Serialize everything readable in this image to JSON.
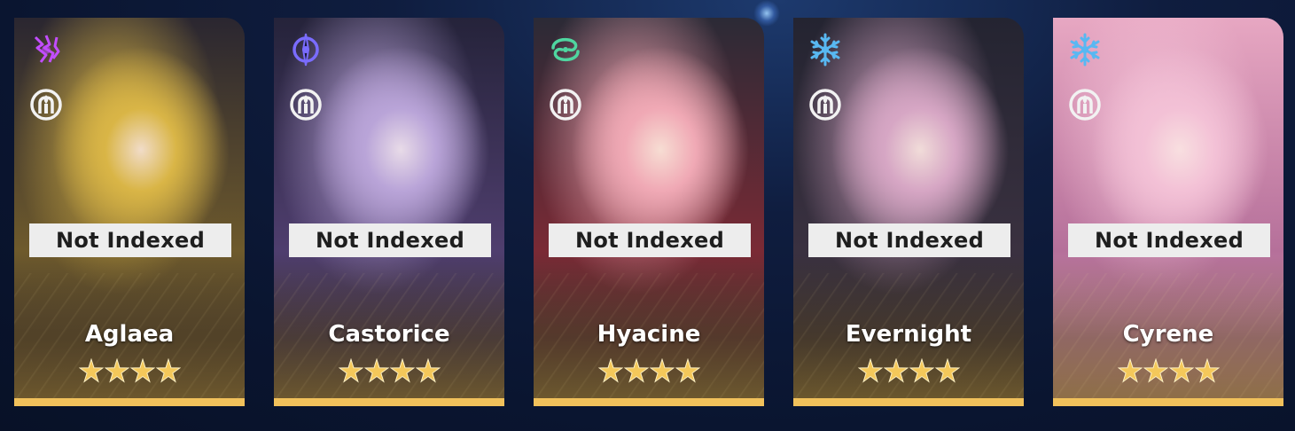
{
  "cards": [
    {
      "name": "Aglaea",
      "status": "Not Indexed",
      "element": "lightning-icon",
      "element_color": "#c24dff",
      "path": "remembrance-icon",
      "rarity": 4,
      "art": {
        "top": "#2a2630",
        "mid": "#6e5a2c",
        "accent": "#d9b546",
        "skin": "#f1dcc8"
      }
    },
    {
      "name": "Castorice",
      "status": "Not Indexed",
      "element": "quantum-icon",
      "element_color": "#7a6cff",
      "path": "remembrance-icon",
      "rarity": 4,
      "art": {
        "top": "#25233a",
        "mid": "#4f3e6e",
        "accent": "#b9a4d8",
        "skin": "#e8dbe8"
      }
    },
    {
      "name": "Hyacine",
      "status": "Not Indexed",
      "element": "wind-icon",
      "element_color": "#4fd6a0",
      "path": "remembrance-icon",
      "rarity": 4,
      "art": {
        "top": "#2b2a36",
        "mid": "#7a2a35",
        "accent": "#f0a9b5",
        "skin": "#f7ddd3"
      }
    },
    {
      "name": "Evernight",
      "status": "Not Indexed",
      "element": "ice-icon",
      "element_color": "#58b8f2",
      "path": "remembrance-icon",
      "rarity": 4,
      "art": {
        "top": "#242431",
        "mid": "#3a3140",
        "accent": "#d6a6c4",
        "skin": "#f1dcd9"
      }
    },
    {
      "name": "Cyrene",
      "status": "Not Indexed",
      "element": "ice-icon",
      "element_color": "#58b8f2",
      "path": "remembrance-icon",
      "rarity": 4,
      "art": {
        "top": "#e7a7c2",
        "mid": "#b5709a",
        "accent": "#f3c1d6",
        "skin": "#f8dfe0"
      }
    }
  ],
  "colors": {
    "status_bg": "#ededed",
    "rarity_bar": "#f1c15b",
    "star": "#f4c85a"
  }
}
